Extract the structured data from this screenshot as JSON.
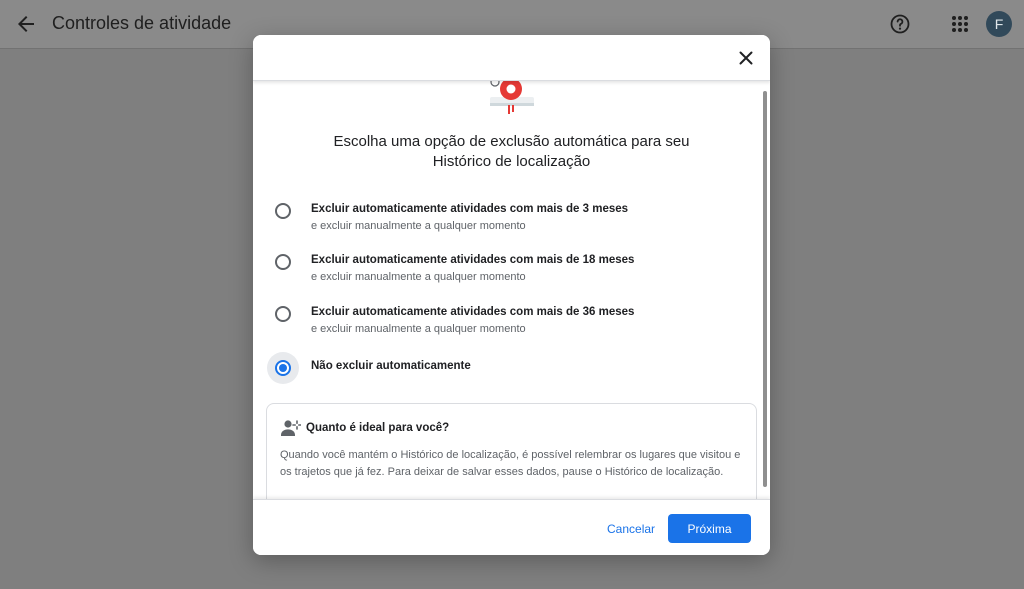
{
  "topbar": {
    "title": "Controles de atividade",
    "avatar_letter": "F",
    "icons": {
      "back": "arrow-back-icon",
      "help": "help-circle-icon",
      "apps": "apps-grid-icon"
    }
  },
  "dialog": {
    "title": "Escolha uma opção de exclusão automática para seu Histórico de localização",
    "options": [
      {
        "main": "Excluir automaticamente atividades com mais de 3 meses",
        "sub": "e excluir manualmente a qualquer momento",
        "selected": false
      },
      {
        "main": "Excluir automaticamente atividades com mais de 18 meses",
        "sub": "e excluir manualmente a qualquer momento",
        "selected": false
      },
      {
        "main": "Excluir automaticamente atividades com mais de 36 meses",
        "sub": "e excluir manualmente a qualquer momento",
        "selected": false
      },
      {
        "main": "Não excluir automaticamente",
        "sub": "",
        "selected": true
      }
    ],
    "info": {
      "title": "Quanto é ideal para você?",
      "text": "Quando você mantém o Histórico de localização, é possível relembrar os lugares que visitou e os trajetos que já fez. Para deixar de salvar esses dados, pause o Histórico de localização."
    },
    "footer": {
      "cancel_label": "Cancelar",
      "next_label": "Próxima"
    }
  },
  "colors": {
    "accent": "#1a73e8",
    "scrim": "#7f7f7f",
    "avatar_bg": "#31495a",
    "illustration_red": "#e53935"
  }
}
